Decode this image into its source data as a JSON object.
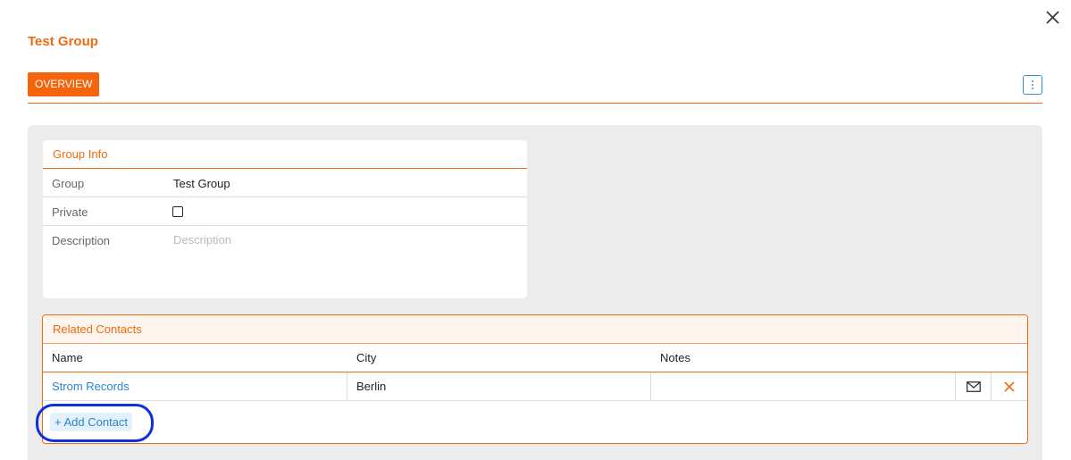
{
  "dialog": {
    "title": "Test Group",
    "tabs": [
      {
        "label": "OVERVIEW",
        "active": true
      }
    ],
    "close_icon": "close-icon",
    "menu_icon": "kebab-menu-icon"
  },
  "group_info": {
    "header": "Group Info",
    "group_label": "Group",
    "group_value": "Test Group",
    "private_label": "Private",
    "private_checked": false,
    "description_label": "Description",
    "description_placeholder": "Description"
  },
  "related_contacts": {
    "header": "Related Contacts",
    "columns": [
      "Name",
      "City",
      "Notes"
    ],
    "rows": [
      {
        "name": "Strom Records",
        "city": "Berlin",
        "notes": "",
        "mail_icon": "mail-icon",
        "remove_icon": "remove-icon"
      }
    ],
    "add_button_label": "+ Add Contact"
  },
  "colors": {
    "accent": "#f06a10",
    "link": "#2a85d2",
    "panel_bg": "#ececec",
    "highlight": "#0d2fdc"
  }
}
